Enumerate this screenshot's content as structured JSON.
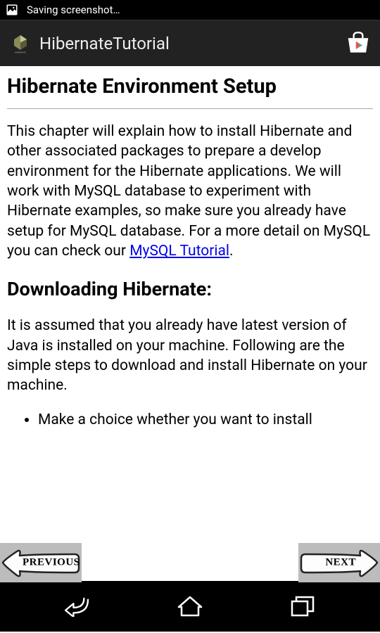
{
  "status_bar": {
    "text": "Saving screenshot…"
  },
  "app_bar": {
    "title": "HibernateTutorial"
  },
  "article": {
    "heading": "Hibernate Environment Setup",
    "intro_part1": "This chapter will explain how to install Hibernate and other associated packages to prepare a develop environment for the Hibernate applications. We will work with MySQL database to experiment with Hibernate examples, so make sure you already have setup for MySQL database. For a more detail on MySQL you can check our ",
    "intro_link": "MySQL Tutorial",
    "intro_part2": ".",
    "section2_heading": "Downloading Hibernate:",
    "section2_body": "It is assumed that you already have latest version of Java is installed on your machine. Following are the simple steps to download and install Hibernate on your machine.",
    "bullet1": "Make a choice whether you want to install"
  },
  "nav": {
    "prev": "PREVIOUS",
    "next": "NEXT"
  }
}
